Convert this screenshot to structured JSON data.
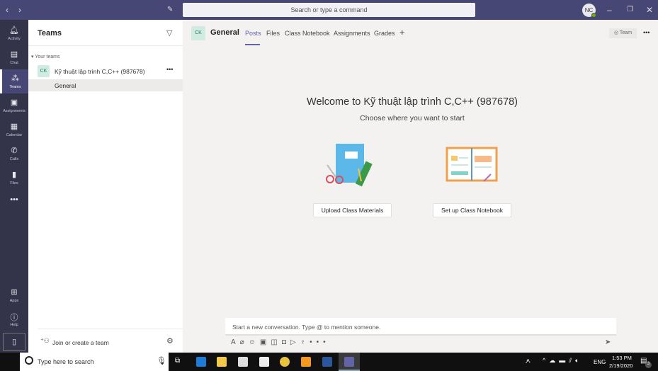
{
  "topbar": {
    "search_placeholder": "Search or type a command",
    "avatar": "NC"
  },
  "rail": [
    {
      "label": "Activity",
      "icon": "bell-icon"
    },
    {
      "label": "Chat",
      "icon": "chat-icon"
    },
    {
      "label": "Teams",
      "icon": "teams-icon"
    },
    {
      "label": "Assignments",
      "icon": "assignments-icon"
    },
    {
      "label": "Calendar",
      "icon": "calendar-icon"
    },
    {
      "label": "Calls",
      "icon": "phone-icon"
    },
    {
      "label": "Files",
      "icon": "file-icon"
    },
    {
      "label": "Apps",
      "icon": "apps-icon"
    },
    {
      "label": "Help",
      "icon": "help-icon"
    }
  ],
  "panel": {
    "title": "Teams",
    "section": "Your teams",
    "team_initials": "CK",
    "team_name": "Kỹ thuật lập trình C,C++ (987678)",
    "channel": "General",
    "join": "Join or create a team"
  },
  "header": {
    "initials": "CK",
    "channel": "General",
    "tabs": [
      "Posts",
      "Files",
      "Class Notebook",
      "Assignments",
      "Grades"
    ],
    "team_button": "Team"
  },
  "welcome": {
    "title": "Welcome to Kỹ thuật lập trình C,C++ (987678)",
    "subtitle": "Choose where you want to start",
    "upload": "Upload Class Materials",
    "notebook": "Set up Class Notebook"
  },
  "compose": {
    "placeholder": "Start a new conversation. Type @ to mention someone."
  },
  "taskbar": {
    "search": "Type here to search",
    "lang": "ENG",
    "time": "1:53 PM",
    "date": "2/19/2020",
    "notifications": "3"
  }
}
